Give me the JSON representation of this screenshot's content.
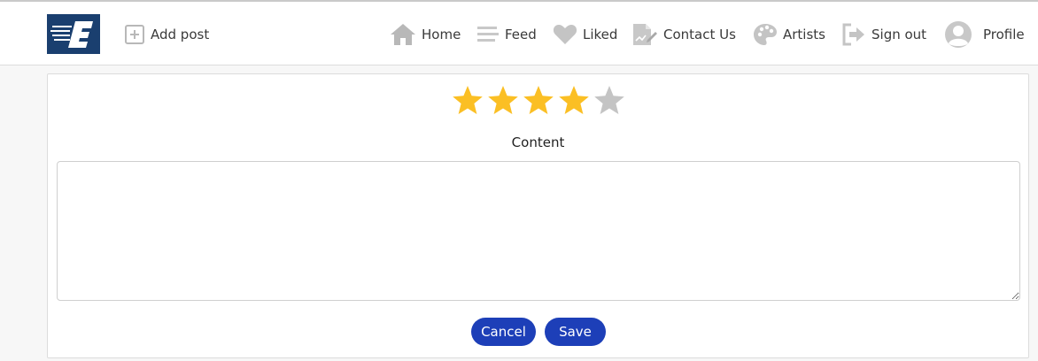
{
  "nav": {
    "add_post": "Add post",
    "home": "Home",
    "feed": "Feed",
    "liked": "Liked",
    "contact": "Contact Us",
    "artists": "Artists",
    "sign_out": "Sign out",
    "profile": "Profile"
  },
  "rating": {
    "value": 4,
    "max": 5
  },
  "form": {
    "content_label": "Content",
    "content_value": "",
    "cancel_label": "Cancel",
    "save_label": "Save"
  },
  "colors": {
    "brand": "#1a3f6f",
    "star_filled": "#fbbf24",
    "star_empty": "#c4c4c4",
    "button": "#1d3fb8",
    "icon_gray": "#b8b8b8"
  }
}
